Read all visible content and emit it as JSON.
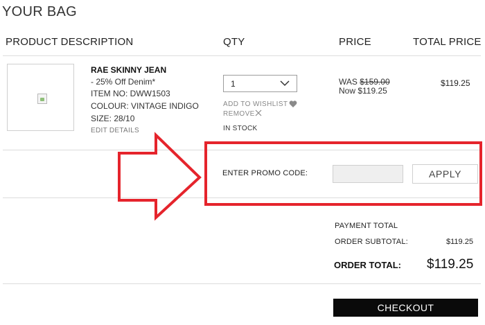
{
  "page": {
    "title": "YOUR BAG"
  },
  "columns": {
    "product_description": "PRODUCT DESCRIPTION",
    "qty": "QTY",
    "price": "PRICE",
    "total_price": "TOTAL PRICE"
  },
  "item": {
    "name": "RAE SKINNY JEAN",
    "discount": "- 25% Off Denim*",
    "item_no": "ITEM NO: DWW1503",
    "colour": "COLOUR: VINTAGE INDIGO",
    "size": "SIZE: 28/10",
    "edit_details": "EDIT DETAILS",
    "qty_value": "1",
    "add_to_wishlist": "ADD TO WISHLIST",
    "remove": "REMOVE",
    "stock_status": "IN STOCK",
    "was_label": "WAS",
    "was_price": "$159.00",
    "now_price": "Now $119.25",
    "total_price": "$119.25"
  },
  "promo": {
    "label": "ENTER PROMO CODE:",
    "input_value": "",
    "apply_label": "APPLY"
  },
  "summary": {
    "payment_total_heading": "PAYMENT TOTAL",
    "order_subtotal_label": "ORDER SUBTOTAL:",
    "order_subtotal_value": "$119.25",
    "order_total_label": "ORDER TOTAL:",
    "order_total_value": "$119.25"
  },
  "checkout": {
    "label": "CHECKOUT"
  },
  "icons": {
    "qty_dropdown": "chevron-down-icon",
    "wishlist": "heart-icon",
    "remove": "close-icon",
    "product_image": "broken-image-icon",
    "annotation": "arrow-right-icon"
  },
  "colors": {
    "annotation_red": "#e5242c",
    "checkout_bg": "#0a0a0a",
    "divider": "#dcdcdc"
  }
}
